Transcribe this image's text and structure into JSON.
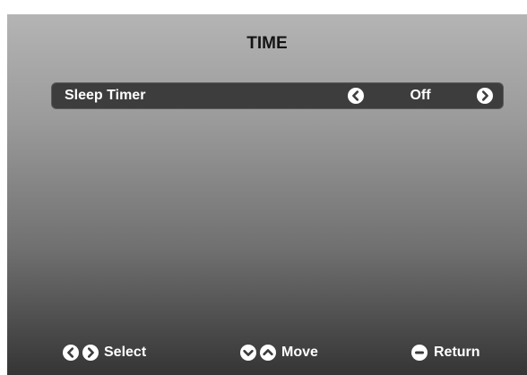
{
  "menu": {
    "title": "TIME"
  },
  "rows": [
    {
      "label": "Sleep Timer",
      "value": "Off"
    }
  ],
  "footer": {
    "select_label": "Select",
    "move_label": "Move",
    "return_label": "Return"
  },
  "icons": {
    "row_prev": "chevron-left-circle-icon",
    "row_next": "chevron-right-circle-icon",
    "select_left": "chevron-left-circle-icon",
    "select_right": "chevron-right-circle-icon",
    "move_down": "chevron-down-circle-icon",
    "move_up": "chevron-up-circle-icon",
    "return": "return-circle-icon"
  },
  "colors": {
    "title_text": "#141414",
    "row_background": "#3d3d3d",
    "text": "#ffffff"
  }
}
